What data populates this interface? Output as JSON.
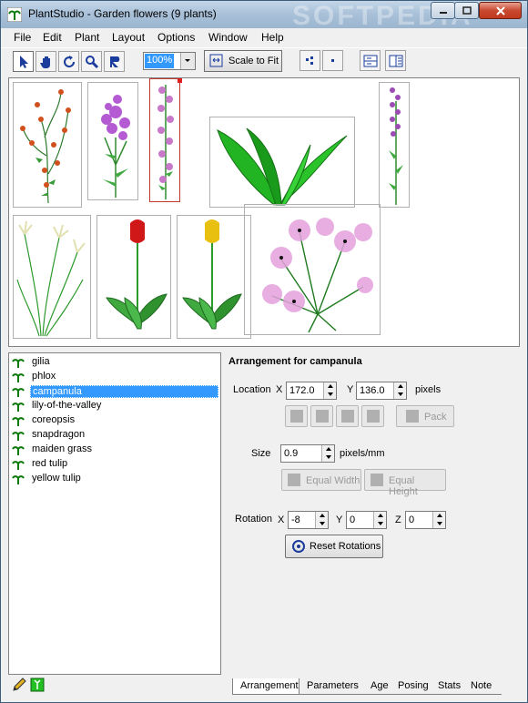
{
  "window": {
    "title": "PlantStudio - Garden flowers (9 plants)",
    "watermark": "SOFTPEDIA"
  },
  "menu": [
    "File",
    "Edit",
    "Plant",
    "Layout",
    "Options",
    "Window",
    "Help"
  ],
  "toolbar": {
    "tools": [
      "arrow-select-icon",
      "hand-icon",
      "rotate-icon",
      "magnify-icon",
      "posing-icon"
    ],
    "zoom_value": "100%",
    "scale_to_fit_label": "Scale to Fit"
  },
  "plants": [
    {
      "name": "gilia",
      "selected": false
    },
    {
      "name": "phlox",
      "selected": false
    },
    {
      "name": "campanula",
      "selected": true
    },
    {
      "name": "lily-of-the-valley",
      "selected": false
    },
    {
      "name": "coreopsis",
      "selected": false
    },
    {
      "name": "snapdragon",
      "selected": false
    },
    {
      "name": "maiden grass",
      "selected": false
    },
    {
      "name": "red tulip",
      "selected": false
    },
    {
      "name": "yellow tulip",
      "selected": false
    }
  ],
  "panel": {
    "heading": "Arrangement for campanula",
    "location_label": "Location",
    "x_label": "X",
    "y_label": "Y",
    "z_label": "Z",
    "location_x": "172.0",
    "location_y": "136.0",
    "location_units": "pixels",
    "pack_label": "Pack",
    "size_label": "Size",
    "size_value": "0.9",
    "size_units": "pixels/mm",
    "equal_width_label": "Equal Width",
    "equal_height_label": "Equal Height",
    "rotation_label": "Rotation",
    "rotation_x": "-8",
    "rotation_y": "0",
    "rotation_z": "0",
    "reset_rotations_label": "Reset Rotations"
  },
  "tabs": [
    "Arrangement",
    "Parameters",
    "Age",
    "Posing",
    "Stats",
    "Note"
  ],
  "active_tab": "Arrangement",
  "colors": {
    "selection": "#3399ff",
    "selected_plant_box": "#c0392b",
    "leaf_green": "#22b422"
  }
}
